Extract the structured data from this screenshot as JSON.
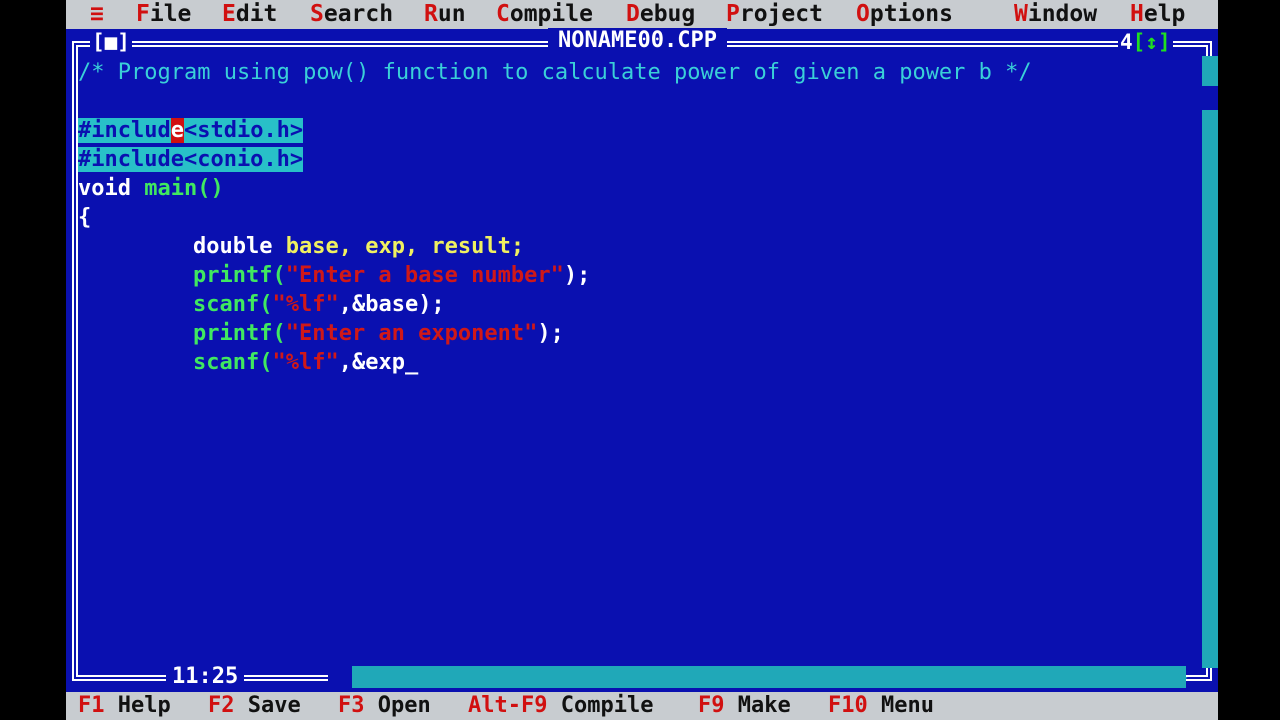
{
  "menu": [
    {
      "hotkey": "≡",
      "rest": ""
    },
    {
      "hotkey": "F",
      "rest": "ile"
    },
    {
      "hotkey": "E",
      "rest": "dit"
    },
    {
      "hotkey": "S",
      "rest": "earch"
    },
    {
      "hotkey": "R",
      "rest": "un"
    },
    {
      "hotkey": "C",
      "rest": "ompile"
    },
    {
      "hotkey": "D",
      "rest": "ebug"
    },
    {
      "hotkey": "P",
      "rest": "roject"
    },
    {
      "hotkey": "O",
      "rest": "ptions"
    },
    {
      "hotkey": "W",
      "rest": "indow"
    },
    {
      "hotkey": "H",
      "rest": "elp"
    }
  ],
  "window": {
    "title": "NONAME00.CPP",
    "close_box": "[■]",
    "number": "4",
    "zoom_box": "[↕]"
  },
  "code": {
    "comment": "/* Program using pow() function to calculate power of given a power b */",
    "include1_pre": "#includ",
    "include1_cursor": "e",
    "include1_post": "<stdio.h>",
    "include2": "#include<conio.h>",
    "main_void": "void",
    "main_name": "main()",
    "open_brace": "{",
    "decl_type": "double",
    "decl_vars": "base, exp, result;",
    "printf1_fn": "printf(",
    "printf1_str": "\"Enter a base number\"",
    "printf1_end": ");",
    "scanf1_fn": "scanf(",
    "scanf1_str": "\"%lf\"",
    "scanf1_end": ",&base);",
    "printf2_fn": "printf(",
    "printf2_str": "\"Enter an exponent\"",
    "printf2_end": ");",
    "scanf2_fn": "scanf(",
    "scanf2_str": "\"%lf\"",
    "scanf2_end": ",&exp",
    "caret": "_"
  },
  "cursor_position": "11:25",
  "status": [
    {
      "key": "F1",
      "label": "Help"
    },
    {
      "key": "F2",
      "label": "Save"
    },
    {
      "key": "F3",
      "label": "Open"
    },
    {
      "key": "Alt-F9",
      "label": "Compile"
    },
    {
      "key": "F9",
      "label": "Make"
    },
    {
      "key": "F10",
      "label": "Menu"
    }
  ],
  "colors": {
    "editor_bg": "#0a10b0",
    "menu_bg": "#c8ccd0",
    "hotkey": "#d11010",
    "comment": "#3ad0d8",
    "selection": "#28c0c8",
    "string": "#d01818"
  }
}
